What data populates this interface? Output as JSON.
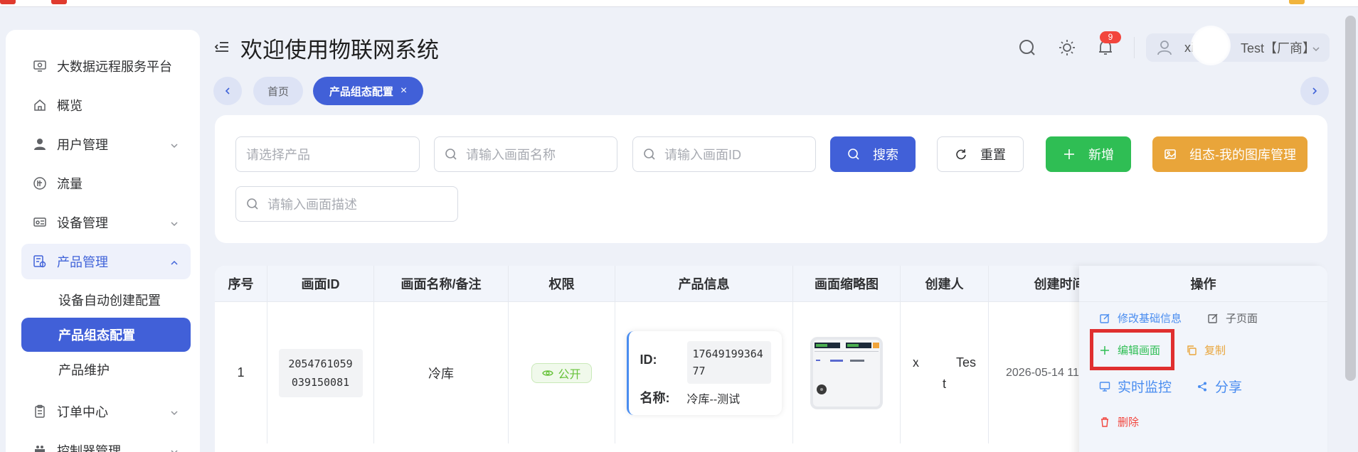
{
  "header": {
    "title": "欢迎使用物联网系统",
    "notification_count": "9",
    "user_name_start": "xi",
    "user_name_end": "Test【厂商】"
  },
  "sidebar": {
    "items": [
      {
        "label": "大数据远程服务平台",
        "icon": "monitor-icon"
      },
      {
        "label": "概览",
        "icon": "home-icon"
      },
      {
        "label": "用户管理",
        "icon": "user-icon"
      },
      {
        "label": "流量",
        "icon": "flow-icon"
      },
      {
        "label": "设备管理",
        "icon": "device-icon"
      },
      {
        "label": "产品管理",
        "icon": "product-icon"
      },
      {
        "label": "订单中心",
        "icon": "clipboard-icon"
      },
      {
        "label": "控制器管理",
        "icon": "controller-icon"
      }
    ],
    "sub_items": [
      {
        "label": "设备自动创建配置"
      },
      {
        "label": "产品组态配置"
      },
      {
        "label": "产品维护"
      }
    ]
  },
  "tabs": {
    "home": "首页",
    "current": "产品组态配置",
    "close": "×"
  },
  "filters": {
    "product_placeholder": "请选择产品",
    "name_placeholder": "请输入画面名称",
    "id_placeholder": "请输入画面ID",
    "desc_placeholder": "请输入画面描述"
  },
  "buttons": {
    "search": "搜索",
    "reset": "重置",
    "add": "新增",
    "gallery": "组态-我的图库管理"
  },
  "table": {
    "columns": [
      "序号",
      "画面ID",
      "画面名称/备注",
      "权限",
      "产品信息",
      "画面缩略图",
      "创建人",
      "创建时间",
      "操作"
    ],
    "rows": [
      {
        "index": "1",
        "screen_id": "2054761059039150081",
        "screen_name": "冷库",
        "permission": "公开",
        "product_id_label": "ID:",
        "product_id": "1764919936477",
        "product_name_label": "名称:",
        "product_name": "冷库--测试",
        "creator_start": "x",
        "creator_end": "Tes",
        "creator_wrap": "t",
        "created_time": "2026-05-14 11"
      }
    ],
    "operations": {
      "edit_basic": "修改基础信息",
      "sub_page": "子页面",
      "edit_screen": "编辑画面",
      "copy": "复制",
      "monitor": "实时监控",
      "share": "分享",
      "delete": "删除"
    }
  },
  "colors": {
    "primary": "#4160d8",
    "success": "#2fbe54",
    "warning": "#e9a53a",
    "danger": "#f2453d",
    "highlight": "#e02f2f"
  }
}
